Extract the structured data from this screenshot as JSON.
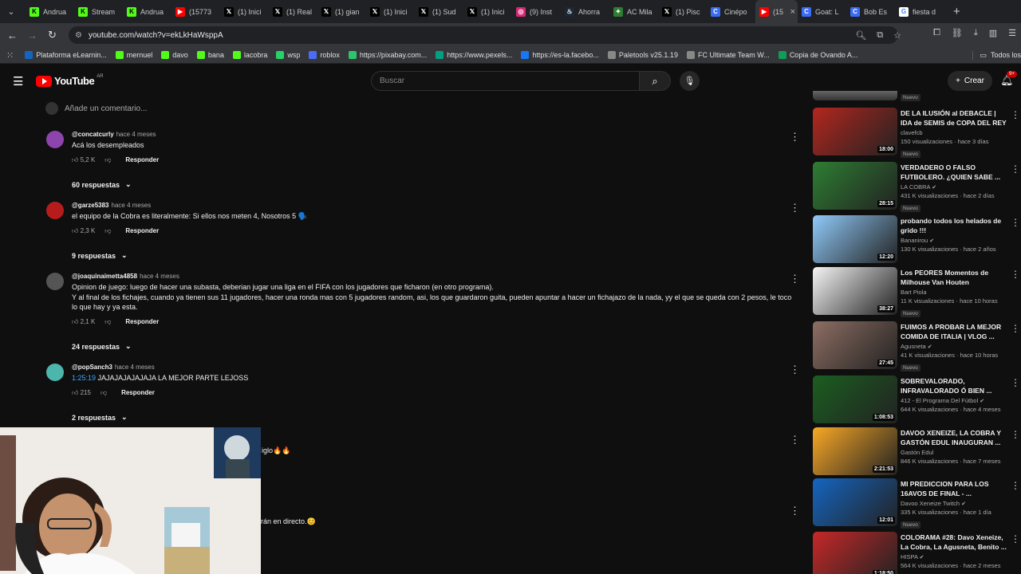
{
  "browser": {
    "tabs": [
      {
        "label": "Andrua",
        "icon": "kick-icon",
        "color": "#53fc18"
      },
      {
        "label": "Stream",
        "icon": "kick-icon",
        "color": "#53fc18"
      },
      {
        "label": "Andrua",
        "icon": "kick-icon",
        "color": "#53fc18"
      },
      {
        "label": "(15773",
        "icon": "youtube-icon",
        "color": "#ff0000"
      },
      {
        "label": "(1) Inici",
        "icon": "x-icon",
        "color": "#000000"
      },
      {
        "label": "(1) Real",
        "icon": "x-icon",
        "color": "#000000"
      },
      {
        "label": "(1) gian",
        "icon": "x-icon",
        "color": "#000000"
      },
      {
        "label": "(1) Inici",
        "icon": "x-icon",
        "color": "#000000"
      },
      {
        "label": "(1) Sud",
        "icon": "x-icon",
        "color": "#000000"
      },
      {
        "label": "(1) Inici",
        "icon": "x-icon",
        "color": "#000000"
      },
      {
        "label": "(9) Inst",
        "icon": "instagram-icon",
        "color": "#d62976"
      },
      {
        "label": "Ahorra",
        "icon": "steam-icon",
        "color": "#1b2838"
      },
      {
        "label": "AC Mila",
        "icon": "game-icon",
        "color": "#2e7d32"
      },
      {
        "label": "(1) Pisc",
        "icon": "x-icon",
        "color": "#000000"
      },
      {
        "label": "Cinépo",
        "icon": "copilot-icon",
        "color": "#3b6cf6"
      },
      {
        "label": "(15",
        "icon": "youtube-icon",
        "color": "#ff0000",
        "active": true
      },
      {
        "label": "Goat: L",
        "icon": "copilot-icon",
        "color": "#3b6cf6"
      },
      {
        "label": "Bob Es",
        "icon": "copilot-icon",
        "color": "#3b6cf6"
      },
      {
        "label": "fiesta d",
        "icon": "google-icon",
        "color": "#ffffff"
      }
    ],
    "url": "youtube.com/watch?v=ekLkHaWsppA",
    "bookmarks": [
      {
        "label": "Plataforma eLearnin...",
        "color": "#1565c0"
      },
      {
        "label": "mernuel",
        "color": "#53fc18"
      },
      {
        "label": "davo",
        "color": "#53fc18"
      },
      {
        "label": "bana",
        "color": "#53fc18"
      },
      {
        "label": "lacobra",
        "color": "#53fc18"
      },
      {
        "label": "wsp",
        "color": "#25d366"
      },
      {
        "label": "roblox",
        "color": "#4a6cf7"
      },
      {
        "label": "https://pixabay.com...",
        "color": "#2ec66d"
      },
      {
        "label": "https://www.pexels...",
        "color": "#05a081"
      },
      {
        "label": "https://es-la.facebo...",
        "color": "#1877f2"
      },
      {
        "label": "Paletools v25.1.19",
        "color": "#888888"
      },
      {
        "label": "FC Ultimate Team W...",
        "color": "#888888"
      },
      {
        "label": "Copia de Ovando A...",
        "color": "#0f9d58"
      }
    ],
    "all_bookmarks": "Todos los"
  },
  "header": {
    "logo_text": "YouTube",
    "country": "AR",
    "search_placeholder": "Buscar",
    "create_label": "Crear",
    "notifications": "9+"
  },
  "comments_section": {
    "add_comment": "Añade un comentario...",
    "comments": [
      {
        "author": "@concatcurly",
        "time": "hace 4 meses",
        "text": "Acá los desempleados",
        "likes": "5,2 K",
        "reply": "Responder",
        "replies": "60 respuestas",
        "avatar": "#8e44ad"
      },
      {
        "author": "@garze5383",
        "time": "hace 4 meses",
        "text": "el equipo de la Cobra es literalmente: Si ellos nos meten 4, Nosotros 5 🗣️",
        "likes": "2,3 K",
        "reply": "Responder",
        "replies": "9 respuestas",
        "avatar": "#b71c1c"
      },
      {
        "author": "@joaquinaimetta4858",
        "time": "hace 4 meses",
        "text": "Opinion de juego: luego de hacer una subasta, deberian jugar una liga en el FIFA con los jugadores que ficharon (en otro programa).",
        "text2": "Y al final de los fichajes, cuando ya tienen sus 11 jugadores, hacer una ronda mas con 5 jugadores random, asi, los que guardaron guita, pueden apuntar a hacer un fichajazo de la nada, yy el que se queda con 2 pesos, le toco lo que hay y ya esta.",
        "likes": "2,1 K",
        "reply": "Responder",
        "replies": "24 respuestas",
        "avatar": "#555555"
      },
      {
        "author": "@popSanch3",
        "time": "hace 4 meses",
        "timestamp": "1:25:19",
        "text": " JAJAJAJAJAJAJA LA MEJOR PARTE LEJOSS",
        "likes": "215",
        "reply": "Responder",
        "replies": "2 respuestas",
        "avatar": "#4db6ac"
      }
    ],
    "partial_1": "iglo🔥🔥",
    "partial_2": "rán en directo.😊"
  },
  "sidebar": {
    "top_badge": "Nuevo",
    "videos": [
      {
        "title": "DE LA ILUSIÓN al DEBACLE | IDA de SEMIS de COPA DEL REY",
        "channel": "clavefcb",
        "stats": "150 visualizaciones · hace 3 días",
        "duration": "18:00",
        "badge": "Nuevo",
        "verified": false,
        "thumb": "#b3261e"
      },
      {
        "title": "VERDADERO O FALSO FUTBOLERO. ¿QUIEN SABE ...",
        "channel": "LA COBRA",
        "stats": "431 K visualizaciones · hace 2 días",
        "duration": "28:15",
        "badge": "Nuevo",
        "verified": true,
        "thumb": "#2e7d32"
      },
      {
        "title": "probando todos los helados de grido !!!",
        "channel": "Bananirou",
        "stats": "130 K visualizaciones · hace 2 años",
        "duration": "12:20",
        "badge": "",
        "verified": true,
        "thumb": "#90caf9"
      },
      {
        "title": "Los PEORES Momentos de Milhouse Van Houten",
        "channel": "Bart Piola",
        "stats": "11 K visualizaciones · hace 10 horas",
        "duration": "38:27",
        "badge": "Nuevo",
        "verified": false,
        "thumb": "#f5f5f5"
      },
      {
        "title": "FUIMOS A PROBAR LA MEJOR COMIDA DE ITALIA | VLOG ...",
        "channel": "Agusneta",
        "stats": "41 K visualizaciones · hace 10 horas",
        "duration": "27:45",
        "badge": "Nuevo",
        "verified": true,
        "thumb": "#8d6e63"
      },
      {
        "title": "SOBREVALORADO, INFRAVALORADO Ó BIEN ...",
        "channel": "412 - El Programa Del Fútbol",
        "stats": "644 K visualizaciones · hace 4 meses",
        "duration": "1:08:53",
        "badge": "",
        "verified": true,
        "thumb": "#1b5e20"
      },
      {
        "title": "DAVOO XENEIZE, LA COBRA Y GASTÓN EDUL INAUGURAN ...",
        "channel": "Gastón Edul",
        "stats": "846 K visualizaciones · hace 7 meses",
        "duration": "2:21:53",
        "badge": "",
        "verified": false,
        "thumb": "#f9a825"
      },
      {
        "title": "MI PREDICCION PARA LOS 16AVOS DE FINAL - ...",
        "channel": "Davoo Xeneize Twitch",
        "stats": "335 K visualizaciones · hace 1 día",
        "duration": "12:01",
        "badge": "Nuevo",
        "verified": true,
        "thumb": "#1565c0"
      },
      {
        "title": "COLORAMA #28: Davo Xeneize, La Cobra, La Agusneta, Benito ...",
        "channel": "HISPA",
        "stats": "564 K visualizaciones · hace 2 meses",
        "duration": "1:18:50",
        "badge": "",
        "verified": true,
        "thumb": "#c62828"
      }
    ]
  }
}
